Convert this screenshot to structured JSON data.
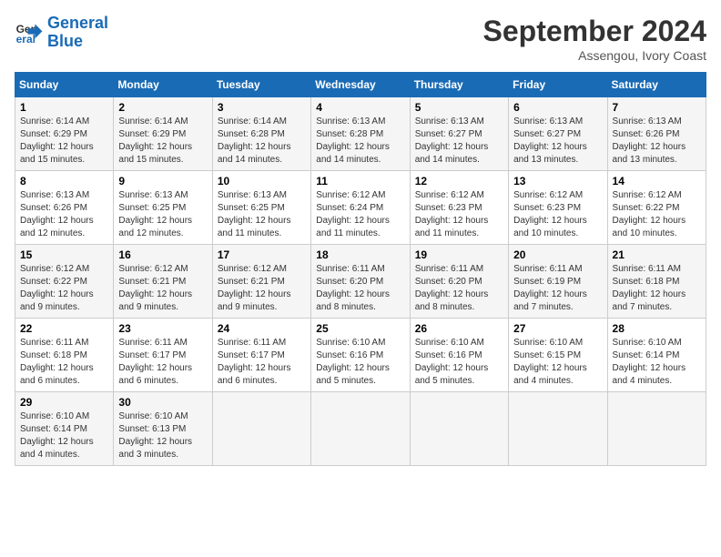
{
  "logo": {
    "line1": "General",
    "line2": "Blue"
  },
  "title": "September 2024",
  "location": "Assengou, Ivory Coast",
  "days_of_week": [
    "Sunday",
    "Monday",
    "Tuesday",
    "Wednesday",
    "Thursday",
    "Friday",
    "Saturday"
  ],
  "weeks": [
    [
      {
        "day": "1",
        "sunrise": "6:14 AM",
        "sunset": "6:29 PM",
        "daylight": "12 hours and 15 minutes."
      },
      {
        "day": "2",
        "sunrise": "6:14 AM",
        "sunset": "6:29 PM",
        "daylight": "12 hours and 15 minutes."
      },
      {
        "day": "3",
        "sunrise": "6:14 AM",
        "sunset": "6:28 PM",
        "daylight": "12 hours and 14 minutes."
      },
      {
        "day": "4",
        "sunrise": "6:13 AM",
        "sunset": "6:28 PM",
        "daylight": "12 hours and 14 minutes."
      },
      {
        "day": "5",
        "sunrise": "6:13 AM",
        "sunset": "6:27 PM",
        "daylight": "12 hours and 14 minutes."
      },
      {
        "day": "6",
        "sunrise": "6:13 AM",
        "sunset": "6:27 PM",
        "daylight": "12 hours and 13 minutes."
      },
      {
        "day": "7",
        "sunrise": "6:13 AM",
        "sunset": "6:26 PM",
        "daylight": "12 hours and 13 minutes."
      }
    ],
    [
      {
        "day": "8",
        "sunrise": "6:13 AM",
        "sunset": "6:26 PM",
        "daylight": "12 hours and 12 minutes."
      },
      {
        "day": "9",
        "sunrise": "6:13 AM",
        "sunset": "6:25 PM",
        "daylight": "12 hours and 12 minutes."
      },
      {
        "day": "10",
        "sunrise": "6:13 AM",
        "sunset": "6:25 PM",
        "daylight": "12 hours and 11 minutes."
      },
      {
        "day": "11",
        "sunrise": "6:12 AM",
        "sunset": "6:24 PM",
        "daylight": "12 hours and 11 minutes."
      },
      {
        "day": "12",
        "sunrise": "6:12 AM",
        "sunset": "6:23 PM",
        "daylight": "12 hours and 11 minutes."
      },
      {
        "day": "13",
        "sunrise": "6:12 AM",
        "sunset": "6:23 PM",
        "daylight": "12 hours and 10 minutes."
      },
      {
        "day": "14",
        "sunrise": "6:12 AM",
        "sunset": "6:22 PM",
        "daylight": "12 hours and 10 minutes."
      }
    ],
    [
      {
        "day": "15",
        "sunrise": "6:12 AM",
        "sunset": "6:22 PM",
        "daylight": "12 hours and 9 minutes."
      },
      {
        "day": "16",
        "sunrise": "6:12 AM",
        "sunset": "6:21 PM",
        "daylight": "12 hours and 9 minutes."
      },
      {
        "day": "17",
        "sunrise": "6:12 AM",
        "sunset": "6:21 PM",
        "daylight": "12 hours and 9 minutes."
      },
      {
        "day": "18",
        "sunrise": "6:11 AM",
        "sunset": "6:20 PM",
        "daylight": "12 hours and 8 minutes."
      },
      {
        "day": "19",
        "sunrise": "6:11 AM",
        "sunset": "6:20 PM",
        "daylight": "12 hours and 8 minutes."
      },
      {
        "day": "20",
        "sunrise": "6:11 AM",
        "sunset": "6:19 PM",
        "daylight": "12 hours and 7 minutes."
      },
      {
        "day": "21",
        "sunrise": "6:11 AM",
        "sunset": "6:18 PM",
        "daylight": "12 hours and 7 minutes."
      }
    ],
    [
      {
        "day": "22",
        "sunrise": "6:11 AM",
        "sunset": "6:18 PM",
        "daylight": "12 hours and 6 minutes."
      },
      {
        "day": "23",
        "sunrise": "6:11 AM",
        "sunset": "6:17 PM",
        "daylight": "12 hours and 6 minutes."
      },
      {
        "day": "24",
        "sunrise": "6:11 AM",
        "sunset": "6:17 PM",
        "daylight": "12 hours and 6 minutes."
      },
      {
        "day": "25",
        "sunrise": "6:10 AM",
        "sunset": "6:16 PM",
        "daylight": "12 hours and 5 minutes."
      },
      {
        "day": "26",
        "sunrise": "6:10 AM",
        "sunset": "6:16 PM",
        "daylight": "12 hours and 5 minutes."
      },
      {
        "day": "27",
        "sunrise": "6:10 AM",
        "sunset": "6:15 PM",
        "daylight": "12 hours and 4 minutes."
      },
      {
        "day": "28",
        "sunrise": "6:10 AM",
        "sunset": "6:14 PM",
        "daylight": "12 hours and 4 minutes."
      }
    ],
    [
      {
        "day": "29",
        "sunrise": "6:10 AM",
        "sunset": "6:14 PM",
        "daylight": "12 hours and 4 minutes."
      },
      {
        "day": "30",
        "sunrise": "6:10 AM",
        "sunset": "6:13 PM",
        "daylight": "12 hours and 3 minutes."
      },
      null,
      null,
      null,
      null,
      null
    ]
  ]
}
